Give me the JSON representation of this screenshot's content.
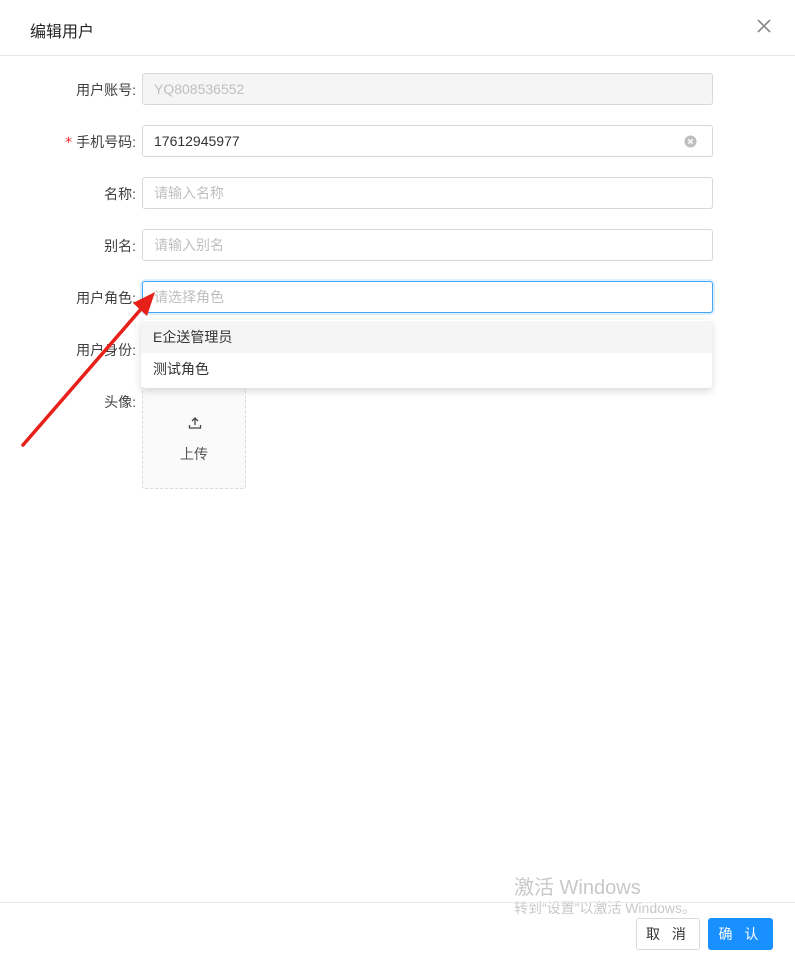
{
  "modal": {
    "title": "编辑用户"
  },
  "form": {
    "account": {
      "label": "用户账号",
      "value": "YQ808536552"
    },
    "phone": {
      "required_mark": "*",
      "label": "手机号码",
      "value": "17612945977"
    },
    "name": {
      "label": "名称",
      "placeholder": "请输入名称"
    },
    "alias": {
      "label": "别名",
      "placeholder": "请输入别名"
    },
    "role": {
      "label": "用户角色",
      "placeholder": "请选择角色"
    },
    "identity": {
      "label": "用户身份"
    },
    "avatar": {
      "label": "头像",
      "upload_text": "上传"
    }
  },
  "dropdown": {
    "options": [
      "E企送管理员",
      "测试角色"
    ]
  },
  "footer": {
    "cancel_label": "取 消",
    "ok_label": "确 认"
  },
  "watermark": {
    "line1": "激活 Windows",
    "line2": "转到“设置”以激活 Windows。"
  },
  "colors": {
    "primary": "#1890ff",
    "annotation_arrow": "#e8201a",
    "required": "#f5222d"
  },
  "icons": [
    "close-icon",
    "clear-icon",
    "upload-icon"
  ]
}
